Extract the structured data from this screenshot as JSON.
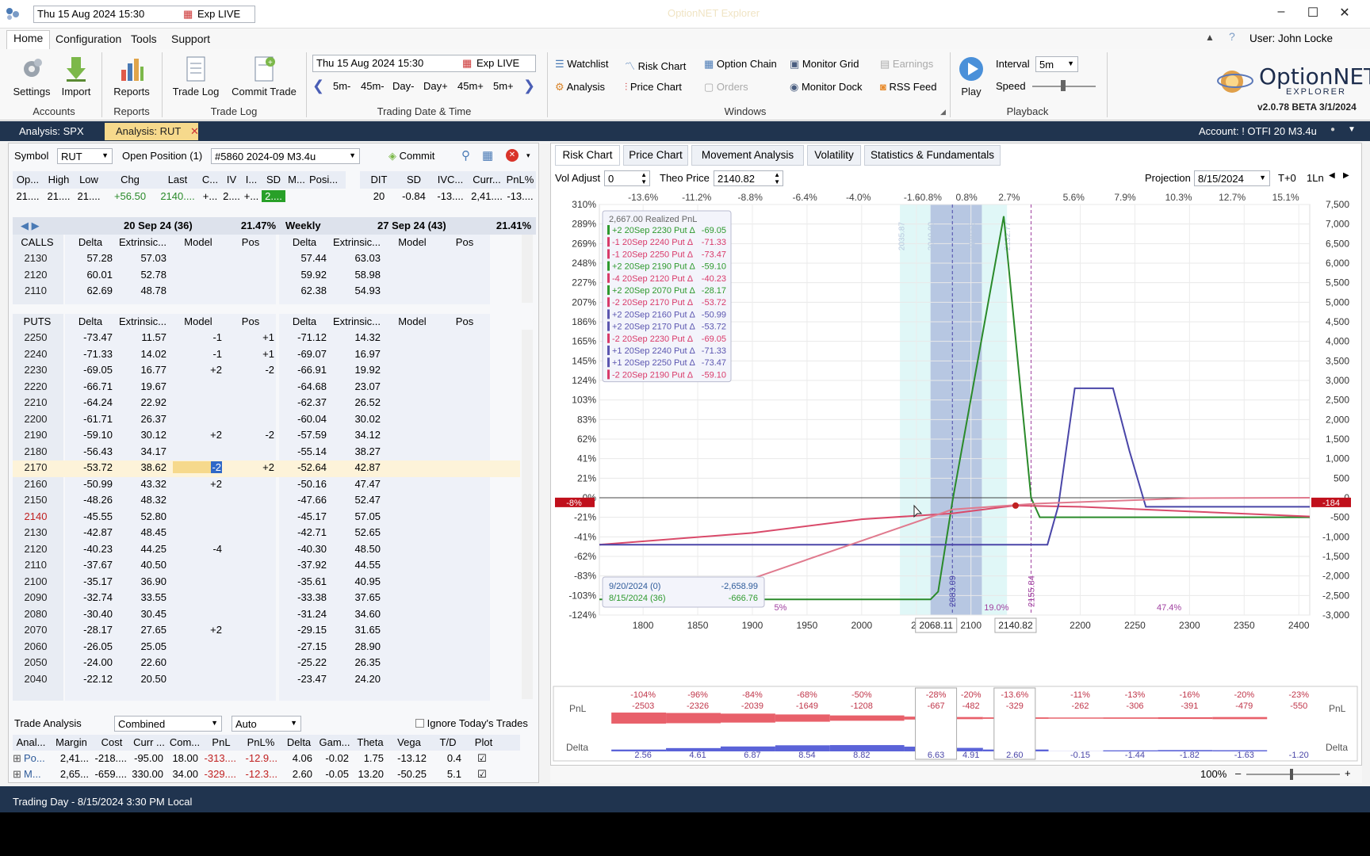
{
  "titlebar": {
    "datetime": "Thu 15 Aug 2024 15:30",
    "exp": "Exp LIVE",
    "title": "OptionNET Explorer"
  },
  "menu": [
    "Home",
    "Configuration",
    "Tools",
    "Support"
  ],
  "user": "User: John Locke",
  "ribbon": {
    "accounts": {
      "label": "Accounts",
      "buttons": [
        "Settings",
        "Import"
      ]
    },
    "reports": {
      "label": "Reports",
      "buttons": [
        "Reports"
      ]
    },
    "tradelog": {
      "label": "Trade Log",
      "buttons": [
        "Trade Log",
        "Commit Trade"
      ]
    },
    "datetime": {
      "label": "Trading Date & Time",
      "value": "Thu 15 Aug 2024 15:30",
      "exp": "Exp LIVE",
      "steps": [
        "5m-",
        "45m-",
        "Day-",
        "Day+",
        "45m+",
        "5m+"
      ]
    },
    "windows": {
      "label": "Windows",
      "items": [
        "Watchlist",
        "Risk Chart",
        "Option Chain",
        "Monitor Grid",
        "Earnings",
        "Analysis",
        "Price Chart",
        "Orders",
        "Monitor Dock",
        "RSS Feed"
      ]
    },
    "playback": {
      "label": "Playback",
      "play": "Play",
      "interval_label": "Interval",
      "interval": "5m",
      "speed_label": "Speed"
    },
    "logo": {
      "name": "OptionNET",
      "sub": "EXPLORER",
      "version": "v2.0.78 BETA 3/1/2024"
    }
  },
  "tabs": [
    "Analysis: SPX",
    "Analysis: RUT"
  ],
  "account": "Account: ! OTFI 20 M3.4u",
  "symbol": {
    "label": "Symbol",
    "value": "RUT",
    "open_label": "Open Position (1)",
    "position": "#5860 2024-09 M3.4u",
    "commit": "Commit"
  },
  "quote": {
    "headers": [
      "Op...",
      "High",
      "Low",
      "Chg",
      "Last",
      "C...",
      "IV",
      "I...",
      "SD",
      "M...",
      "Posi..."
    ],
    "values": [
      "21....",
      "21....",
      "21....",
      "+56.50",
      "2140....",
      "+...",
      "2....",
      "+...",
      "2....",
      "",
      ""
    ],
    "headers2": [
      "DIT",
      "SD",
      "IVC...",
      "Curr...",
      "PnL%"
    ],
    "values2": [
      "20",
      "-0.84",
      "-13....",
      "2,41....",
      "-13...."
    ]
  },
  "expiries": [
    {
      "name": "20 Sep 24 (36)",
      "iv": "21.47%"
    },
    {
      "name": "27 Sep 24 (43)",
      "iv": "21.41%",
      "tag": "Weekly"
    }
  ],
  "calls": {
    "label": "CALLS",
    "cols": [
      "Delta",
      "Extrinsic...",
      "Model",
      "Pos"
    ],
    "rows": [
      {
        "strike": "2130",
        "d1": "57.28",
        "e1": "57.03",
        "d2": "57.44",
        "e2": "63.03"
      },
      {
        "strike": "2120",
        "d1": "60.01",
        "e1": "52.78",
        "d2": "59.92",
        "e2": "58.98"
      },
      {
        "strike": "2110",
        "d1": "62.69",
        "e1": "48.78",
        "d2": "62.38",
        "e2": "54.93"
      }
    ]
  },
  "puts": {
    "label": "PUTS",
    "cols": [
      "Delta",
      "Extrinsic...",
      "Model",
      "Pos"
    ],
    "rows": [
      {
        "strike": "2250",
        "d1": "-73.47",
        "e1": "11.57",
        "m": "-1",
        "p": "+1",
        "d2": "-71.12",
        "e2": "14.32"
      },
      {
        "strike": "2240",
        "d1": "-71.33",
        "e1": "14.02",
        "m": "-1",
        "p": "+1",
        "d2": "-69.07",
        "e2": "16.97"
      },
      {
        "strike": "2230",
        "d1": "-69.05",
        "e1": "16.77",
        "m": "+2",
        "p": "-2",
        "d2": "-66.91",
        "e2": "19.92"
      },
      {
        "strike": "2220",
        "d1": "-66.71",
        "e1": "19.67",
        "m": "",
        "p": "",
        "d2": "-64.68",
        "e2": "23.07"
      },
      {
        "strike": "2210",
        "d1": "-64.24",
        "e1": "22.92",
        "m": "",
        "p": "",
        "d2": "-62.37",
        "e2": "26.52"
      },
      {
        "strike": "2200",
        "d1": "-61.71",
        "e1": "26.37",
        "m": "",
        "p": "",
        "d2": "-60.04",
        "e2": "30.02"
      },
      {
        "strike": "2190",
        "d1": "-59.10",
        "e1": "30.12",
        "m": "+2",
        "p": "-2",
        "d2": "-57.59",
        "e2": "34.12"
      },
      {
        "strike": "2180",
        "d1": "-56.43",
        "e1": "34.17",
        "m": "",
        "p": "",
        "d2": "-55.14",
        "e2": "38.27"
      },
      {
        "strike": "2170",
        "d1": "-53.72",
        "e1": "38.62",
        "m": "-2",
        "p": "+2",
        "d2": "-52.64",
        "e2": "42.87"
      },
      {
        "strike": "2160",
        "d1": "-50.99",
        "e1": "43.32",
        "m": "+2",
        "p": "",
        "d2": "-50.16",
        "e2": "47.47"
      },
      {
        "strike": "2150",
        "d1": "-48.26",
        "e1": "48.32",
        "m": "",
        "p": "",
        "d2": "-47.66",
        "e2": "52.47"
      },
      {
        "strike": "2140",
        "d1": "-45.55",
        "e1": "52.80",
        "m": "",
        "p": "",
        "d2": "-45.17",
        "e2": "57.05"
      },
      {
        "strike": "2130",
        "d1": "-42.87",
        "e1": "48.45",
        "m": "",
        "p": "",
        "d2": "-42.71",
        "e2": "52.65"
      },
      {
        "strike": "2120",
        "d1": "-40.23",
        "e1": "44.25",
        "m": "-4",
        "p": "",
        "d2": "-40.30",
        "e2": "48.50"
      },
      {
        "strike": "2110",
        "d1": "-37.67",
        "e1": "40.50",
        "m": "",
        "p": "",
        "d2": "-37.92",
        "e2": "44.55"
      },
      {
        "strike": "2100",
        "d1": "-35.17",
        "e1": "36.90",
        "m": "",
        "p": "",
        "d2": "-35.61",
        "e2": "40.95"
      },
      {
        "strike": "2090",
        "d1": "-32.74",
        "e1": "33.55",
        "m": "",
        "p": "",
        "d2": "-33.38",
        "e2": "37.65"
      },
      {
        "strike": "2080",
        "d1": "-30.40",
        "e1": "30.45",
        "m": "",
        "p": "",
        "d2": "-31.24",
        "e2": "34.60"
      },
      {
        "strike": "2070",
        "d1": "-28.17",
        "e1": "27.65",
        "m": "+2",
        "p": "",
        "d2": "-29.15",
        "e2": "31.65"
      },
      {
        "strike": "2060",
        "d1": "-26.05",
        "e1": "25.05",
        "m": "",
        "p": "",
        "d2": "-27.15",
        "e2": "28.90"
      },
      {
        "strike": "2050",
        "d1": "-24.00",
        "e1": "22.60",
        "m": "",
        "p": "",
        "d2": "-25.22",
        "e2": "26.35"
      },
      {
        "strike": "2040",
        "d1": "-22.12",
        "e1": "20.50",
        "m": "",
        "p": "",
        "d2": "-23.47",
        "e2": "24.20"
      }
    ]
  },
  "trade_analysis": {
    "label": "Trade Analysis",
    "mode": "Combined",
    "auto": "Auto",
    "ignore": "Ignore Today's Trades",
    "headers": [
      "Anal...",
      "Margin",
      "Cost",
      "Curr ...",
      "Com...",
      "PnL",
      "PnL%",
      "Delta",
      "Gam...",
      "Theta",
      "Vega",
      "T/D",
      "Plot"
    ],
    "rows": [
      [
        "Po...",
        "2,41...",
        "-218....",
        "-95.00",
        "18.00",
        "-313....",
        "-12.9...",
        "4.06",
        "-0.02",
        "1.75",
        "-13.12",
        "0.4"
      ],
      [
        "M...",
        "2,65...",
        "-659....",
        "330.00",
        "34.00",
        "-329....",
        "-12.3...",
        "2.60",
        "-0.05",
        "13.20",
        "-50.25",
        "5.1"
      ]
    ]
  },
  "status": "Trading Day - 8/15/2024 3:30 PM Local",
  "chart_tabs": [
    "Risk Chart",
    "Price Chart",
    "Movement Analysis",
    "Volatility",
    "Statistics & Fundamentals"
  ],
  "chart_controls": {
    "vol_label": "Vol Adjust",
    "vol": "0",
    "theo_label": "Theo Price",
    "theo": "2140.82",
    "proj_label": "Projection",
    "proj": "8/15/2024",
    "t0": "T+0",
    "ln": "1Ln"
  },
  "zoom": "100%",
  "chart_data": {
    "type": "line",
    "xlim": [
      1760,
      2410
    ],
    "ylim": [
      -3000,
      7500
    ],
    "x_ticks": [
      "1800",
      "1850",
      "1900",
      "1950",
      "2000",
      "20",
      "2100",
      "2200",
      "2250",
      "2300",
      "2350",
      "2400"
    ],
    "y_left_ticks": [
      "310%",
      "289%",
      "269%",
      "248%",
      "227%",
      "207%",
      "186%",
      "165%",
      "145%",
      "124%",
      "103%",
      "83%",
      "62%",
      "41%",
      "21%",
      "0%",
      "-21%",
      "-41%",
      "-62%",
      "-83%",
      "-103%",
      "-124%"
    ],
    "y_right_ticks": [
      "7,500",
      "7,000",
      "6,500",
      "6,000",
      "5,500",
      "5,000",
      "4,500",
      "4,000",
      "3,500",
      "3,000",
      "2,500",
      "2,000",
      "1,500",
      "1,000",
      "500",
      "0",
      "-500",
      "-1,000",
      "-1,500",
      "-2,000",
      "-2,500",
      "-3,000"
    ],
    "top_ticks": [
      "-13.6%",
      "-11.2%",
      "-8.8%",
      "-6.4%",
      "-4.0%",
      "-1.6",
      "-0.8%",
      "0.8%",
      "2.7%",
      "5.6%",
      "7.9%",
      "10.3%",
      "12.7%",
      "15.1%"
    ],
    "vlines": [
      "2035.87",
      "2040.00",
      "2100.55",
      "2132.77",
      "2083.09",
      "2155.84"
    ],
    "markers": {
      "x1": "2068.11",
      "x2": "2140.82",
      "left_pnl": "-8%",
      "right_val": "-184",
      "pct_left": "5%",
      "pct_mid": "19.0%",
      "pct_right": "47.4%"
    },
    "legend_title": "2,667.00 Realized PnL",
    "legend": [
      {
        "text": "+2 20Sep 2230 Put Δ",
        "val": "-69.05",
        "color": "#2e9a2e"
      },
      {
        "text": "-1 20Sep 2240 Put Δ",
        "val": "-71.33",
        "color": "#d93a6a"
      },
      {
        "text": "-1 20Sep 2250 Put Δ",
        "val": "-73.47",
        "color": "#d93a6a"
      },
      {
        "text": "+2 20Sep 2190 Put Δ",
        "val": "-59.10",
        "color": "#2e9a2e"
      },
      {
        "text": "-4 20Sep 2120 Put Δ",
        "val": "-40.23",
        "color": "#d93a6a"
      },
      {
        "text": "+2 20Sep 2070 Put Δ",
        "val": "-28.17",
        "color": "#2e9a2e"
      },
      {
        "text": "-2 20Sep 2170 Put Δ",
        "val": "-53.72",
        "color": "#d93a6a"
      },
      {
        "text": "+2 20Sep 2160 Put Δ",
        "val": "-50.99",
        "color": "#5b56b0"
      },
      {
        "text": "+2 20Sep 2170 Put Δ",
        "val": "-53.72",
        "color": "#5b56b0"
      },
      {
        "text": "-2 20Sep 2230 Put Δ",
        "val": "-69.05",
        "color": "#d93a6a"
      },
      {
        "text": "+1 20Sep 2240 Put Δ",
        "val": "-71.33",
        "color": "#5b56b0"
      },
      {
        "text": "+1 20Sep 2250 Put Δ",
        "val": "-73.47",
        "color": "#5b56b0"
      },
      {
        "text": "-2 20Sep 2190 Put Δ",
        "val": "-59.10",
        "color": "#d93a6a"
      }
    ],
    "info_box": [
      {
        "label": "9/20/2024 (0)",
        "value": "-2,658.99",
        "color": "#2e5b9a"
      },
      {
        "label": "8/15/2024 (36)",
        "value": "-666.76",
        "color": "#2e9a2e"
      }
    ],
    "series": [
      {
        "name": "9/20/2024 (0)",
        "color": "#2a8a2a",
        "x": [
          1760,
          2063,
          2070,
          2083,
          2130,
          2155,
          2163,
          2410
        ],
        "y": [
          -2600,
          -2600,
          -2400,
          -100,
          7200,
          0,
          -500,
          -500
        ]
      },
      {
        "name": "8/15/2024 (36)",
        "color": "#d94a6a",
        "x": [
          1760,
          1900,
          2000,
          2083,
          2140,
          2200,
          2300,
          2410
        ],
        "y": [
          -1200,
          -900,
          -550,
          -400,
          -200,
          -230,
          -350,
          -480
        ]
      },
      {
        "name": "Pos",
        "color": "#4a46a8",
        "x": [
          1760,
          2170,
          2180,
          2195,
          2230,
          2245,
          2260,
          2410
        ],
        "y": [
          -1200,
          -1200,
          -200,
          2800,
          2800,
          1200,
          -230,
          -230
        ]
      },
      {
        "name": "Mod",
        "color": "#e07a8e",
        "x": [
          1855,
          2000,
          2083,
          2160,
          2300,
          2410
        ],
        "y": [
          -2500,
          -1100,
          -300,
          -150,
          -10,
          0
        ]
      }
    ],
    "pnl_band": {
      "x": [
        "1800",
        "1850",
        "1900",
        "1950",
        "2000",
        "2068",
        "2100",
        "2140",
        "2200",
        "2250",
        "2300",
        "2350",
        "2400"
      ],
      "pct": [
        "-104%",
        "-96%",
        "-84%",
        "-68%",
        "-50%",
        "-28%",
        "-20%",
        "-13.6%",
        "-11%",
        "-13%",
        "-16%",
        "-20%",
        "-23%"
      ],
      "val": [
        "-2503",
        "-2326",
        "-2039",
        "-1649",
        "-1208",
        "-667",
        "-482",
        "-329",
        "-262",
        "-306",
        "-391",
        "-479",
        "-550"
      ],
      "delta": [
        "2.56",
        "4.61",
        "6.87",
        "8.54",
        "8.82",
        "6.63",
        "4.91",
        "2.60",
        "-0.15",
        "-1.44",
        "-1.82",
        "-1.63",
        "-1.20"
      ]
    }
  }
}
